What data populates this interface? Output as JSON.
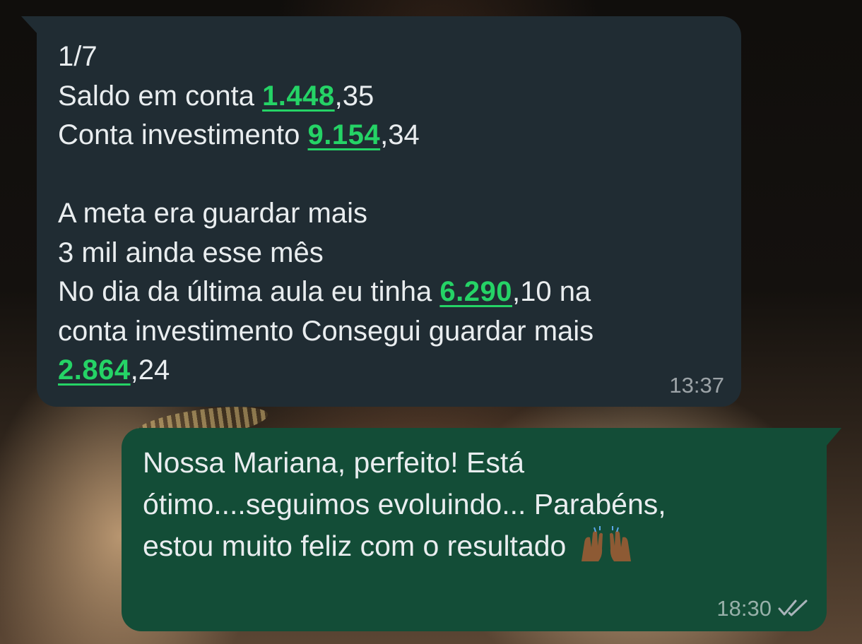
{
  "colors": {
    "incoming_bubble": "#202c33",
    "outgoing_bubble": "#134d37",
    "text": "#e9edef",
    "link_number": "#25d366",
    "timestamp": "#8696a0"
  },
  "messages": [
    {
      "direction": "incoming",
      "lines": [
        {
          "parts": [
            {
              "text": "1/7"
            }
          ]
        },
        {
          "parts": [
            {
              "text": "Saldo em conta "
            },
            {
              "text": "1.448",
              "highlight": true
            },
            {
              "text": ",35"
            }
          ]
        },
        {
          "parts": [
            {
              "text": "Conta investimento "
            },
            {
              "text": "9.154",
              "highlight": true
            },
            {
              "text": ",34"
            }
          ]
        },
        {
          "parts": []
        },
        {
          "parts": [
            {
              "text": "A meta era guardar mais"
            }
          ]
        },
        {
          "parts": [
            {
              "text": "3 mil ainda esse mês"
            }
          ]
        },
        {
          "parts": [
            {
              "text": "No dia da última aula eu tinha "
            },
            {
              "text": "6.290",
              "highlight": true
            },
            {
              "text": ",10 na"
            }
          ]
        },
        {
          "parts": [
            {
              "text": "conta investimento Consegui guardar mais"
            }
          ]
        },
        {
          "parts": [
            {
              "text": "2.864",
              "highlight": true
            },
            {
              "text": ",24"
            }
          ]
        }
      ],
      "time": "13:37"
    },
    {
      "direction": "outgoing",
      "lines": [
        {
          "parts": [
            {
              "text": "Nossa Mariana, perfeito! Está"
            }
          ]
        },
        {
          "parts": [
            {
              "text": "ótimo....seguimos evoluindo... Parabéns,"
            }
          ]
        },
        {
          "parts": [
            {
              "text": "estou muito feliz com o resultado "
            }
          ],
          "emoji": "raising-hands-emoji"
        }
      ],
      "time": "18:30",
      "status_icon": "double-check-read-icon"
    }
  ]
}
